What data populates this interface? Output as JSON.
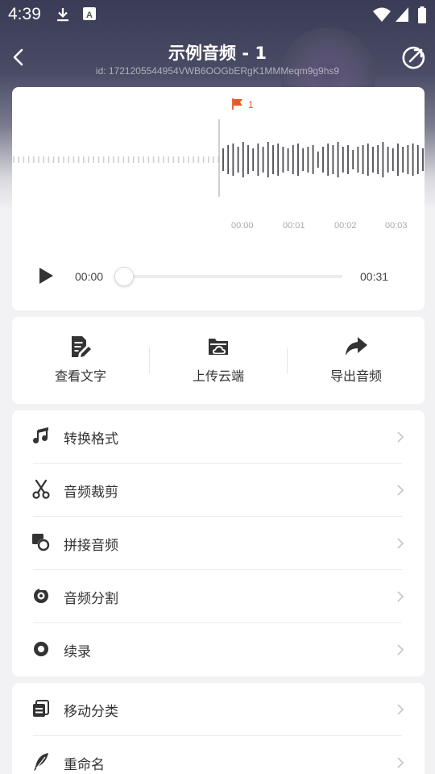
{
  "status_bar": {
    "time": "4:39",
    "icons": [
      "download-icon",
      "keyboard-a-icon",
      "wifi-icon",
      "signal-icon",
      "battery-icon"
    ]
  },
  "header": {
    "title": "示例音频 - 1",
    "subtitle": "id: 1721205544954VWB6OOGbERgK1MMMeqm9g9hs9",
    "back_icon": "back-arrow-icon",
    "share_icon": "share-external-icon"
  },
  "waveform": {
    "marker_number": "1",
    "marker_color": "#e8572a",
    "ticks": [
      "00:00",
      "00:01",
      "00:02",
      "00:03"
    ]
  },
  "player": {
    "current_time": "00:00",
    "total_time": "00:31",
    "progress": 0
  },
  "actions": [
    {
      "label": "查看文字",
      "icon": "document-edit-icon"
    },
    {
      "label": "上传云端",
      "icon": "cloud-folder-icon"
    },
    {
      "label": "导出音频",
      "icon": "share-arrow-icon"
    }
  ],
  "menu_group1": [
    {
      "label": "转换格式",
      "icon": "music-note-icon"
    },
    {
      "label": "音频裁剪",
      "icon": "scissors-icon"
    },
    {
      "label": "拼接音频",
      "icon": "merge-icon"
    },
    {
      "label": "音频分割",
      "icon": "split-icon"
    },
    {
      "label": "续录",
      "icon": "record-icon"
    }
  ],
  "menu_group2": [
    {
      "label": "移动分类",
      "icon": "move-copy-icon"
    },
    {
      "label": "重命名",
      "icon": "feather-icon"
    }
  ],
  "colors": {
    "accent": "#e8572a",
    "header_bg": "#3a3c56",
    "icon_dark": "#333333"
  }
}
